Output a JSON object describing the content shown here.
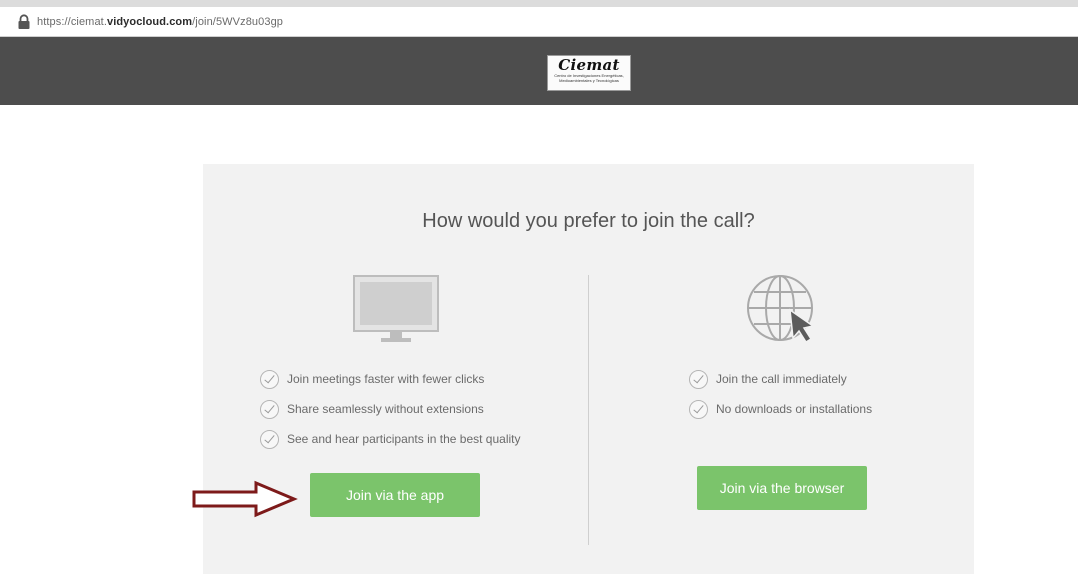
{
  "browser": {
    "url_prefix": "https://ciemat.",
    "url_domain": "vidyocloud.com",
    "url_path": "/join/5WVz8u03gp"
  },
  "header": {
    "logo_text": "Ciemat",
    "logo_subtitle": "Centro de Investigaciones Energéticas, Medioambientales y Tecnológicas"
  },
  "main": {
    "question": "How would you prefer to join the call?",
    "app_option": {
      "features": [
        "Join meetings faster with fewer clicks",
        "Share seamlessly without extensions",
        "See and hear participants in the best quality"
      ],
      "button_label": "Join via the app"
    },
    "browser_option": {
      "features": [
        "Join the call immediately",
        "No downloads or installations"
      ],
      "button_label": "Join via the browser"
    }
  },
  "colors": {
    "header_bg": "#4d4d4d",
    "card_bg": "#f2f2f2",
    "button_green": "#7bc46b",
    "annotation_arrow": "#7d1a1a"
  }
}
